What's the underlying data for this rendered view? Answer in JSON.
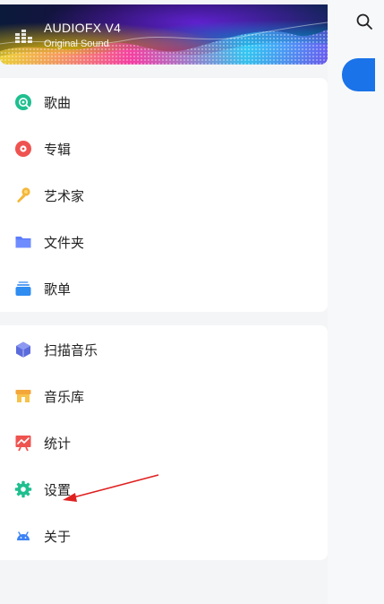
{
  "banner": {
    "title": "AUDIOFX V4",
    "subtitle": "Original Sound"
  },
  "menu_primary": [
    {
      "label": "歌曲",
      "icon": "disc-icon",
      "color": "#1fbf8f"
    },
    {
      "label": "专辑",
      "icon": "album-icon",
      "color": "#ef5350"
    },
    {
      "label": "艺术家",
      "icon": "microphone-icon",
      "color": "#f4b73a"
    },
    {
      "label": "文件夹",
      "icon": "folder-icon",
      "color": "#5c7cfa"
    },
    {
      "label": "歌单",
      "icon": "playlist-icon",
      "color": "#2f8cf0"
    }
  ],
  "menu_secondary": [
    {
      "label": "扫描音乐",
      "icon": "scan-cube-icon",
      "color": "#5b6bdc"
    },
    {
      "label": "音乐库",
      "icon": "store-icon",
      "color": "#f4a63a"
    },
    {
      "label": "统计",
      "icon": "chart-board-icon",
      "color": "#ef5350"
    },
    {
      "label": "设置",
      "icon": "gear-icon",
      "color": "#1fbf8f"
    },
    {
      "label": "关于",
      "icon": "android-icon",
      "color": "#3b82f6"
    }
  ],
  "colors": {
    "fab": "#1a73e8",
    "annotation_arrow": "#e02020"
  }
}
